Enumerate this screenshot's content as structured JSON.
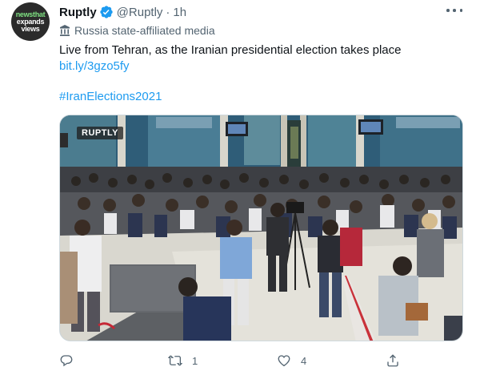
{
  "author": {
    "avatar_text": [
      "newsthat",
      "expands",
      "views"
    ],
    "display_name": "Ruptly",
    "handle": "@Ruptly",
    "separator": "·",
    "time": "1h",
    "label": "Russia state-affiliated media"
  },
  "tweet": {
    "text": "Live from Tehran, as the Iranian presidential election takes place",
    "link": "bit.ly/3gzo5fy",
    "hashtag": "#IranElections2021"
  },
  "media": {
    "channel_badge": "RUPTLY",
    "description_icon": "video-still"
  },
  "actions": {
    "reply_count": "",
    "retweet_count": "1",
    "like_count": "4",
    "share_count": ""
  },
  "colors": {
    "accent": "#1d9bf0",
    "secondary_text": "#536471"
  }
}
